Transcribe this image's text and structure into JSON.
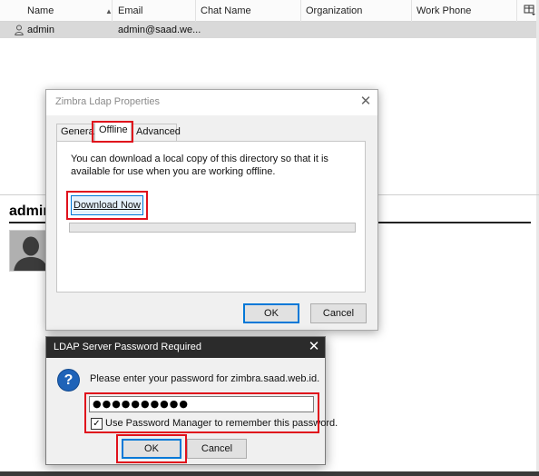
{
  "address_book": {
    "columns": [
      {
        "label": "Name"
      },
      {
        "label": "Email"
      },
      {
        "label": "Chat Name"
      },
      {
        "label": "Organization"
      },
      {
        "label": "Work Phone"
      }
    ],
    "selected_row": {
      "name": "admin",
      "email": "admin@saad.we..."
    },
    "card": {
      "name": "admin"
    }
  },
  "ldap_dialog": {
    "title": "Zimbra Ldap Properties",
    "tabs": [
      {
        "label": "General"
      },
      {
        "label": "Offline",
        "active": true
      },
      {
        "label": "Advanced"
      }
    ],
    "offline_text": "You can download a local copy of this directory so that it is available for use when you are working offline.",
    "download_label": "Download Now",
    "progress_percent": 0,
    "ok_label": "OK",
    "cancel_label": "Cancel"
  },
  "password_dialog": {
    "title": "LDAP Server Password Required",
    "prompt": "Please enter your password for zimbra.saad.web.id.",
    "password_mask": "●●●●●●●●●●",
    "checkbox_checked": true,
    "checkbox_label": "Use Password Manager to remember this password.",
    "ok_label": "OK",
    "cancel_label": "Cancel"
  },
  "icons": {
    "contact": "person-icon",
    "column_picker": "column-picker-icon",
    "question": "question-icon",
    "avatar": "avatar-silhouette-icon"
  },
  "colors": {
    "highlight_red": "#e0111c",
    "focus_blue": "#0078d7",
    "question_blue": "#1f63b8",
    "password_titlebar": "#2b2b2b"
  }
}
